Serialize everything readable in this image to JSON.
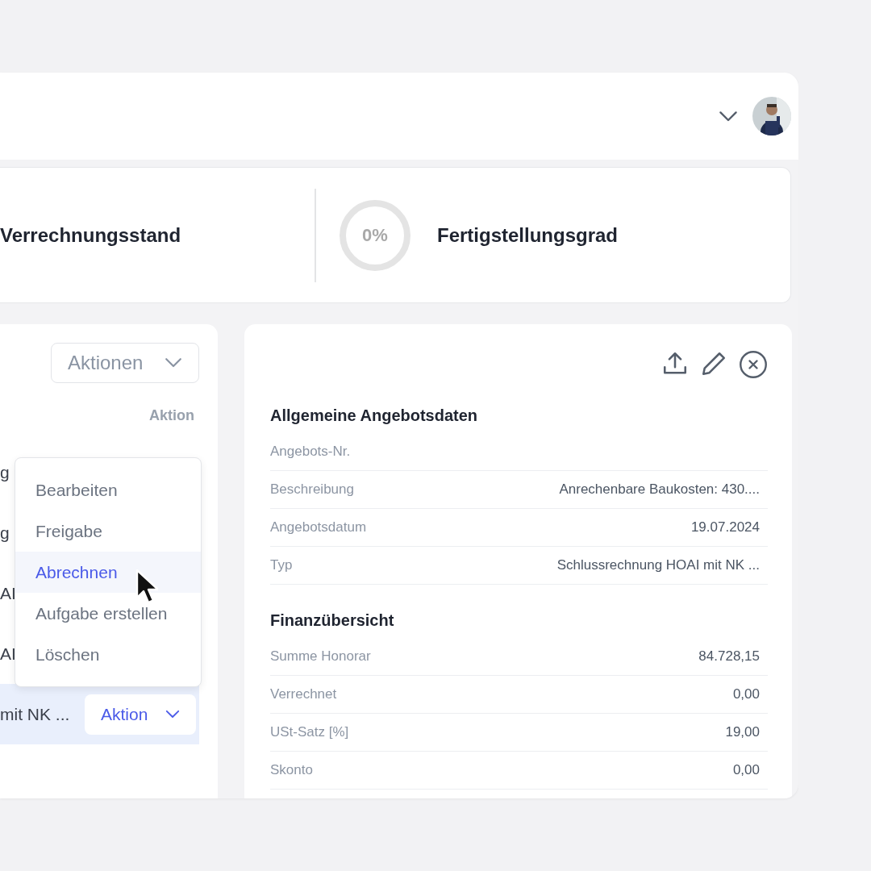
{
  "summary": {
    "billing_title": "Verrechnungsstand",
    "completion": {
      "reading": "0%",
      "title": "Fertigstellungsgrad"
    }
  },
  "list_panel": {
    "actions_button": "Aktionen",
    "column_header": "Aktion",
    "rows": [
      {
        "text": "g",
        "selected": false
      },
      {
        "text": "g",
        "selected": false
      },
      {
        "text": "AI",
        "selected": false
      },
      {
        "text": "AI",
        "selected": false
      },
      {
        "text": "mit NK ...",
        "selected": true,
        "action": "Aktion"
      }
    ],
    "menu": [
      {
        "label": "Bearbeiten",
        "selected": false
      },
      {
        "label": "Freigabe",
        "selected": false
      },
      {
        "label": "Abrechnen",
        "selected": true
      },
      {
        "label": "Aufgabe erstellen",
        "selected": false
      },
      {
        "label": "Löschen",
        "selected": false
      }
    ]
  },
  "detail_panel": {
    "sections": [
      {
        "title": "Allgemeine Angebotsdaten",
        "rows": [
          {
            "label": "Angebots-Nr."
          },
          {
            "label": "Beschreibung",
            "value": "Anrechenbare Baukosten: 430...."
          },
          {
            "label": "Angebotsdatum",
            "value": "19.07.2024"
          },
          {
            "label": "Typ",
            "value": "Schlussrechnung HOAI mit NK ..."
          }
        ]
      },
      {
        "title": "Finanzübersicht",
        "rows": [
          {
            "label": "Summe Honorar",
            "value": "84.728,15"
          },
          {
            "label": "Verrechnet",
            "value": "0,00"
          },
          {
            "label": "USt-Satz [%]",
            "value": "19,00"
          },
          {
            "label": "Skonto",
            "value": "0,00"
          }
        ]
      }
    ]
  }
}
